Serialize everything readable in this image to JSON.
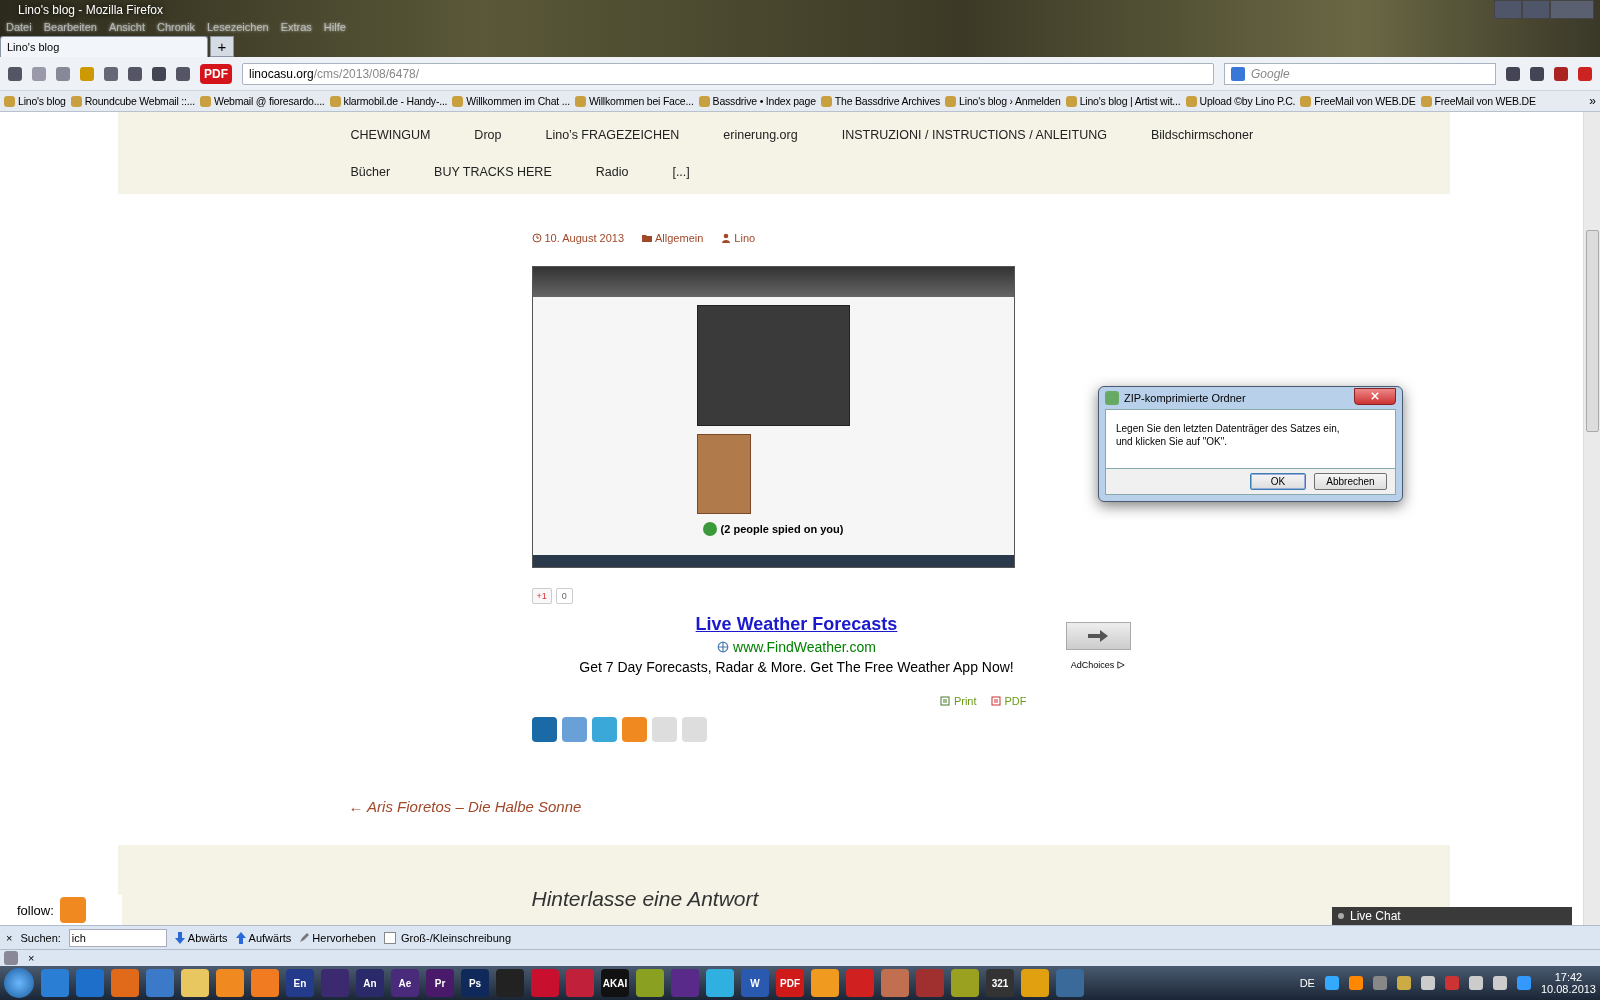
{
  "window": {
    "title": "Lino's blog - Mozilla Firefox"
  },
  "menu": [
    "Datei",
    "Bearbeiten",
    "Ansicht",
    "Chronik",
    "Lesezeichen",
    "Extras",
    "Hilfe"
  ],
  "tabs": [
    {
      "label": "Lino's blog",
      "selected": true
    }
  ],
  "new_tab": "+",
  "pdf_button": "PDF",
  "bookmarks_more": "»",
  "url": {
    "host": "linocasu.org",
    "path": "/cms/2013/08/6478/"
  },
  "search": {
    "placeholder": "Google"
  },
  "bookmarks": [
    "Lino's blog",
    "Roundcube Webmail ::...",
    "Webmail @ fioresardo....",
    "klarmobil.de - Handy-...",
    "Willkommen im Chat ...",
    "Willkommen bei Face...",
    "Bassdrive • Index page",
    "The Bassdrive Archives",
    "Lino's blog › Anmelden",
    "Lino's blog | Artist wit...",
    "Upload ©by Lino P.C.",
    "FreeMail von WEB.DE",
    "FreeMail von WEB.DE"
  ],
  "page": {
    "nav": [
      [
        "CHEWINGUM",
        "Drop",
        "Lino’s FRAGEZEICHEN",
        "erinerung.org",
        "INSTRUZIONI / INSTRUCTIONS / ANLEITUNG",
        "Bildschirmschoner"
      ],
      [
        "Bücher",
        "BUY TRACKS HERE",
        "Radio",
        "[...]"
      ]
    ],
    "meta": {
      "date": "10. August 2013",
      "category": "Allgemein",
      "author": "Lino"
    },
    "embedded": {
      "caption": "(2 people spied on you)"
    },
    "plusone": {
      "label": "+1",
      "count": "0"
    },
    "ad": {
      "title": "Live Weather Forecasts",
      "url": "www.FindWeather.com",
      "text": "Get 7 Day Forecasts, Radar & More. Get The Free Weather App Now!",
      "adchoices": "AdChoices"
    },
    "print_links": [
      "Print",
      "PDF"
    ],
    "prev_post": "← Aris Fioretos – Die Halbe Sonne",
    "reply_heading": "Hinterlasse eine Antwort",
    "follow": "follow:"
  },
  "live_chat": {
    "title": "Live Chat"
  },
  "dialog": {
    "title": "ZIP-komprimierte Ordner",
    "message": [
      "Legen Sie den letzten Datenträger des Satzes ein,",
      "und klicken Sie auf \"OK\"."
    ],
    "buttons": [
      {
        "label": "OK",
        "selected": true
      },
      {
        "label": "Abbrechen",
        "selected": false
      }
    ]
  },
  "find_bar": {
    "close": "×",
    "label": "Suchen:",
    "value": "ich",
    "down": "Abwärts",
    "up": "Aufwärts",
    "highlight": "Hervorheben",
    "case": {
      "label": "Groß-/Kleinschreibung",
      "checked": false
    }
  },
  "addon_bar": {
    "close": "×"
  },
  "taskbar": {
    "apps": [
      {
        "color": "#2a7fd4"
      },
      {
        "color": "#1e6fc9"
      },
      {
        "color": "#e06a1a"
      },
      {
        "color": "#3a7ac8"
      },
      {
        "color": "#e8c660"
      },
      {
        "color": "#f08a20"
      },
      {
        "color": "#f07b20"
      },
      {
        "label": "En",
        "color": "#243a8a"
      },
      {
        "color": "#3b2a70"
      },
      {
        "label": "An",
        "color": "#2a2a6a"
      },
      {
        "label": "Ae",
        "color": "#4a2a7a"
      },
      {
        "label": "Pr",
        "color": "#4a1a6a"
      },
      {
        "label": "Ps",
        "color": "#0f2a5a"
      },
      {
        "color": "#222222"
      },
      {
        "color": "#c8102e"
      },
      {
        "color": "#c0203a"
      },
      {
        "label": "AKAI",
        "color": "#111111"
      },
      {
        "color": "#8aa020"
      },
      {
        "color": "#5a2a8a"
      },
      {
        "color": "#30b0e0"
      },
      {
        "label": "W",
        "color": "#2a5ab0"
      },
      {
        "label": "PDF",
        "color": "#d01a1a"
      },
      {
        "color": "#f09a20"
      },
      {
        "color": "#d02020"
      },
      {
        "color": "#c07050"
      },
      {
        "color": "#a03030"
      },
      {
        "color": "#9aa020"
      },
      {
        "label": "321",
        "color": "#333333"
      },
      {
        "color": "#e0a010"
      },
      {
        "color": "#3a6a9a"
      }
    ],
    "language": "DE",
    "time": "17:42",
    "date": "10.08.2013"
  }
}
